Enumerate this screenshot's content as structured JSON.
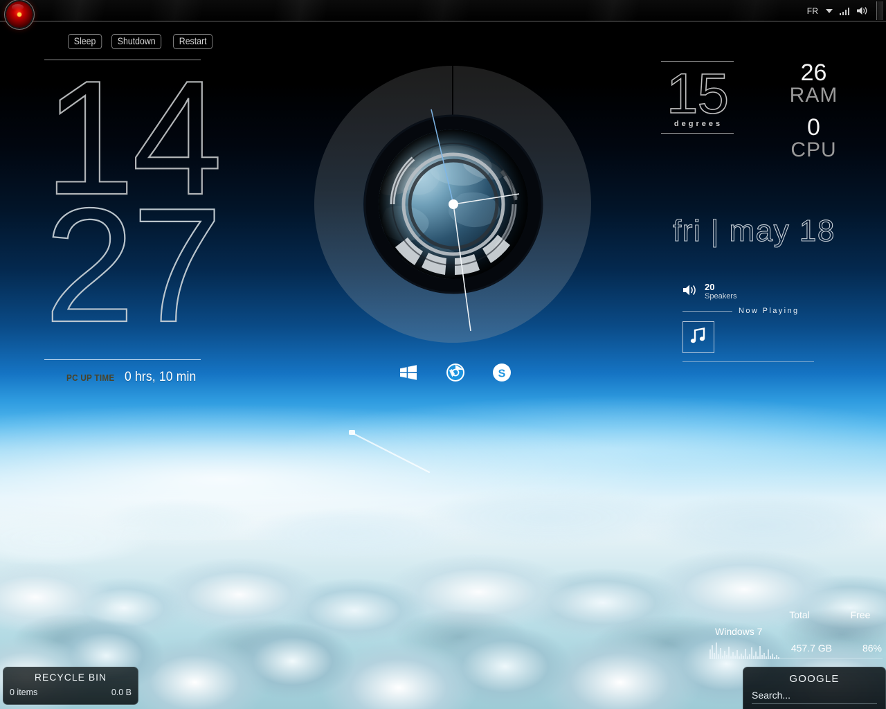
{
  "taskbar": {
    "hal_icon": "hal-eye-icon",
    "language": "FR",
    "caret_icon": "chevron-down-icon",
    "signal_icon": "signal-bars-icon",
    "volume_icon": "volume-icon",
    "show_desktop_label": ""
  },
  "power": {
    "sleep_label": "Sleep",
    "shutdown_label": "Shutdown",
    "restart_label": "Restart"
  },
  "clock": {
    "hours": "14",
    "minutes": "27",
    "uptime_label": "PC UP TIME",
    "uptime_value": "0 hrs, 10 min"
  },
  "temperature": {
    "value": "15",
    "unit_label": "degrees"
  },
  "system": {
    "ram_value": "26",
    "ram_label": "RAM",
    "cpu_value": "0",
    "cpu_label": "CPU"
  },
  "date": {
    "text": "fri | may 18"
  },
  "volume": {
    "icon": "speaker-icon",
    "level": "20",
    "device_label": "Speakers"
  },
  "now_playing": {
    "header": "Now Playing",
    "art_icon": "music-note-icon"
  },
  "dock": {
    "items": [
      {
        "name": "windows-start-icon",
        "label": "Windows"
      },
      {
        "name": "chrome-icon",
        "label": "Chrome"
      },
      {
        "name": "skype-icon",
        "label": "Skype"
      }
    ]
  },
  "disk": {
    "header_total": "Total",
    "header_free": "Free",
    "drive_name": "Windows 7",
    "total": "457.7 GB",
    "free": "86%",
    "graph_icon": "disk-activity-graph"
  },
  "search": {
    "title": "GOOGLE",
    "placeholder": "Search..."
  },
  "recycle_bin": {
    "title": "RECYCLE BIN",
    "items": "0 items",
    "size": "0.0 B"
  },
  "colors": {
    "accent_red": "#c00000",
    "text_light": "#d8d8d8",
    "text_dim": "#9a9a9a",
    "sky_blue": "#1574c4"
  }
}
